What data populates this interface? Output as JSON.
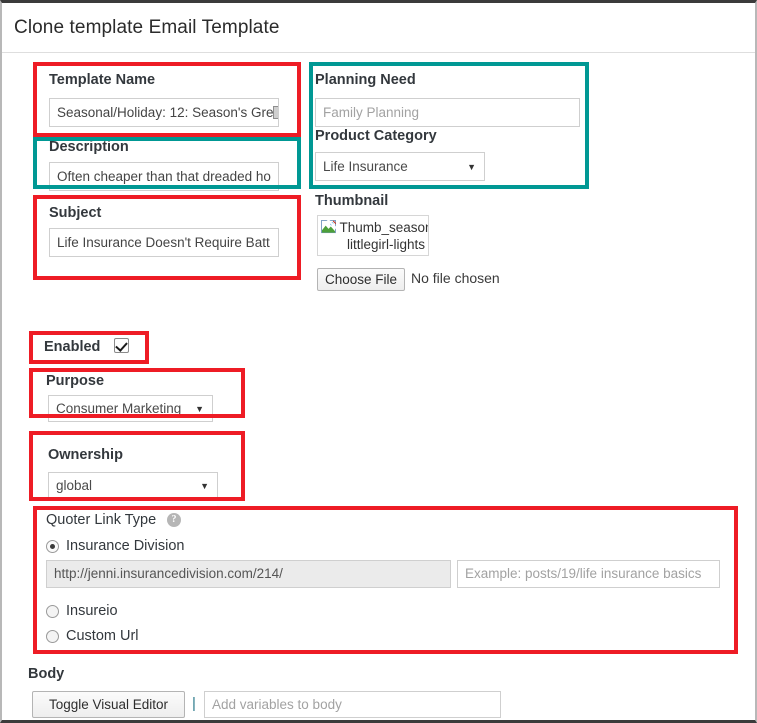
{
  "header": {
    "title": "Clone template Email Template"
  },
  "form": {
    "template_name": {
      "label": "Template Name",
      "value": "Seasonal/Holiday: 12: Season's Gre"
    },
    "description": {
      "label": "Description",
      "value": "Often cheaper than that dreaded ho"
    },
    "subject": {
      "label": "Subject",
      "value": "Life Insurance Doesn't Require Batt"
    },
    "planning_need": {
      "label": "Planning Need",
      "placeholder": "Family Planning"
    },
    "product_category": {
      "label": "Product Category",
      "value": "Life Insurance",
      "arrow": "▼"
    },
    "thumbnail": {
      "label": "Thumbnail",
      "alt_line1": "Thumb_season",
      "alt_line2": "littlegirl-lights",
      "choose_file_button": "Choose File",
      "no_file_text": "No file chosen"
    },
    "enabled": {
      "label": "Enabled",
      "checked": true
    },
    "purpose": {
      "label": "Purpose",
      "value": "Consumer Marketing",
      "arrow": "▼"
    },
    "ownership": {
      "label": "Ownership",
      "value": "global",
      "arrow": "▼"
    },
    "quoter_link_type": {
      "label": "Quoter Link Type",
      "help_glyph": "?",
      "options": [
        {
          "label": "Insurance Division",
          "selected": true
        },
        {
          "label": "Insureio",
          "selected": false
        },
        {
          "label": "Custom Url",
          "selected": false
        }
      ],
      "url_value": "http://jenni.insurancedivision.com/214/",
      "path_placeholder": "Example: posts/19/life insurance basics"
    },
    "body": {
      "label": "Body",
      "toggle_button": "Toggle Visual Editor",
      "separator": "|",
      "variables_placeholder": "Add variables to body"
    }
  },
  "annotations": {
    "red_color": "#ee1c25",
    "teal_color": "#009894"
  }
}
